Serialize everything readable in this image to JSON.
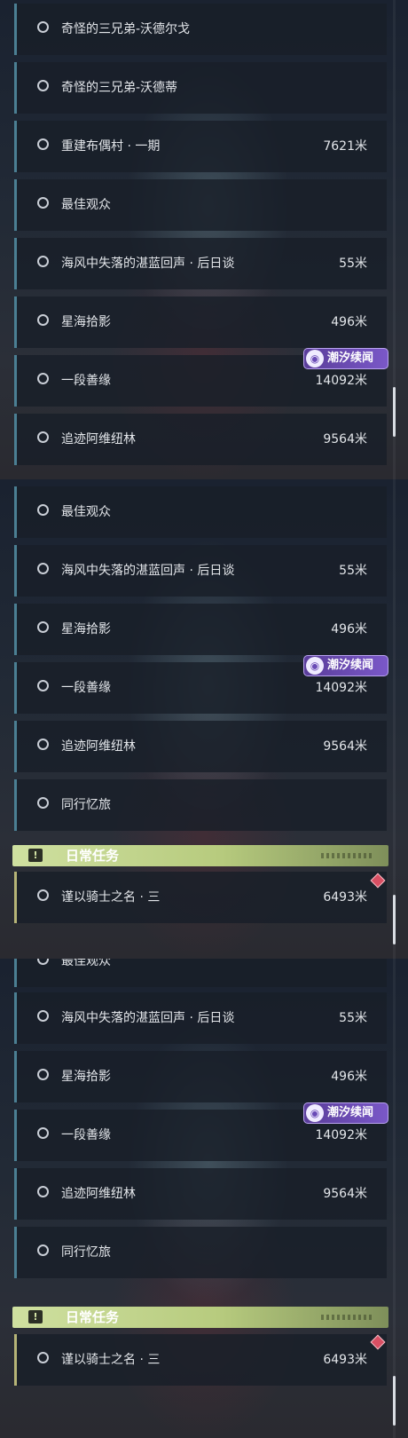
{
  "quests": {
    "a1": {
      "label": "奇怪的三兄弟-沃德尔戈",
      "dist": ""
    },
    "a2": {
      "label": "奇怪的三兄弟-沃德蒂",
      "dist": ""
    },
    "a3": {
      "label": "重建布偶村 · 一期",
      "dist": "7621米"
    },
    "a4": {
      "label": "最佳观众",
      "dist": ""
    },
    "a5": {
      "label": "海风中失落的湛蓝回声 · 后日谈",
      "dist": "55米"
    },
    "a6": {
      "label": "星海拾影",
      "dist": "496米"
    },
    "a7": {
      "label": "一段善缘",
      "dist": "14092米"
    },
    "a8": {
      "label": "追迹阿维纽林",
      "dist": "9564米"
    },
    "b1": {
      "label": "最佳观众",
      "dist": ""
    },
    "b2": {
      "label": "海风中失落的湛蓝回声 · 后日谈",
      "dist": "55米"
    },
    "b3": {
      "label": "星海拾影",
      "dist": "496米"
    },
    "b4": {
      "label": "一段善缘",
      "dist": "14092米"
    },
    "b5": {
      "label": "追迹阿维纽林",
      "dist": "9564米"
    },
    "b6": {
      "label": "同行忆旅",
      "dist": ""
    },
    "b7": {
      "label": "谨以骑士之名 · 三",
      "dist": "6493米"
    },
    "c1": {
      "label": "最佳观众",
      "dist": ""
    },
    "c2": {
      "label": "海风中失落的湛蓝回声 · 后日谈",
      "dist": "55米"
    },
    "c3": {
      "label": "星海拾影",
      "dist": "496米"
    },
    "c4": {
      "label": "一段善缘",
      "dist": "14092米"
    },
    "c5": {
      "label": "追迹阿维纽林",
      "dist": "9564米"
    },
    "c6": {
      "label": "同行忆旅",
      "dist": ""
    },
    "c7": {
      "label": "谨以骑士之名 · 三",
      "dist": "6493米"
    }
  },
  "badge": {
    "label": "潮汐续闻",
    "icon": "tide-swirl-icon"
  },
  "daily": {
    "label": "日常任务",
    "icon": "exclamation-icon",
    "icon_glyph": "!"
  },
  "colors": {
    "accent_blue": "#4b7f93",
    "daily_green": "#b7cb7e",
    "badge_purple": "#6b4bb6",
    "marker_red": "#d94f63"
  }
}
